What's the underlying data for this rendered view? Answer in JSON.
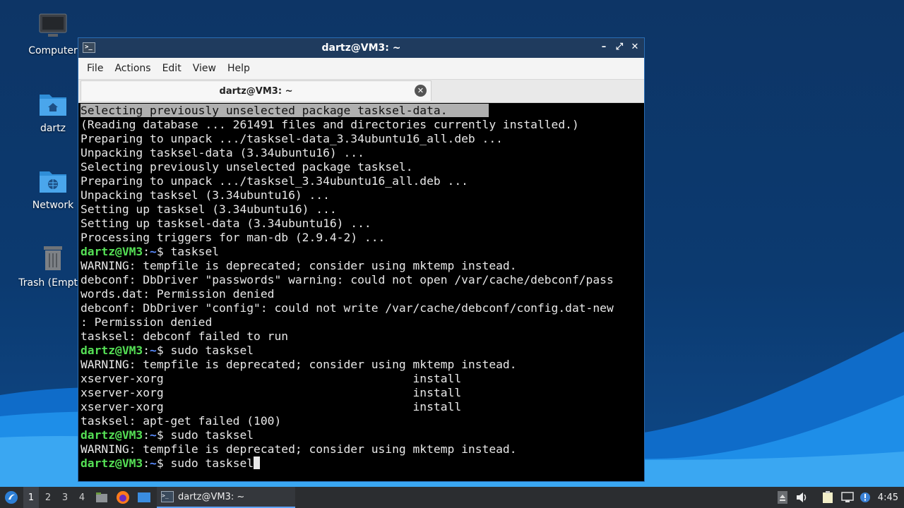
{
  "desktop": {
    "icons": [
      {
        "label": "Computer",
        "icon": "computer-icon"
      },
      {
        "label": "dartz",
        "icon": "home-folder-icon"
      },
      {
        "label": "Network",
        "icon": "network-folder-icon"
      },
      {
        "label": "Trash (Empty)",
        "icon": "trash-icon"
      }
    ]
  },
  "window": {
    "title": "dartz@VM3: ~",
    "controls": {
      "minimize": "–",
      "maximize": "⤢",
      "close": "✕"
    },
    "menu": [
      "File",
      "Actions",
      "Edit",
      "View",
      "Help"
    ],
    "tab": {
      "label": "dartz@VM3: ~",
      "close": "✕"
    }
  },
  "terminal": {
    "prompt_user": "dartz@VM3",
    "prompt_path": "~",
    "prompt_sym": "$",
    "lines": [
      {
        "text": "Selecting previously unselected package tasksel-data.      "
      },
      {
        "text": "(Reading database ... 261491 files and directories currently installed.)"
      },
      {
        "text": "Preparing to unpack .../tasksel-data_3.34ubuntu16_all.deb ..."
      },
      {
        "text": "Unpacking tasksel-data (3.34ubuntu16) ..."
      },
      {
        "text": "Selecting previously unselected package tasksel."
      },
      {
        "text": "Preparing to unpack .../tasksel_3.34ubuntu16_all.deb ..."
      },
      {
        "text": "Unpacking tasksel (3.34ubuntu16) ..."
      },
      {
        "text": "Setting up tasksel (3.34ubuntu16) ..."
      },
      {
        "text": "Setting up tasksel-data (3.34ubuntu16) ..."
      },
      {
        "text": "Processing triggers for man-db (2.9.4-2) ..."
      },
      {
        "cmd": " tasksel"
      },
      {
        "text": "WARNING: tempfile is deprecated; consider using mktemp instead."
      },
      {
        "text": "debconf: DbDriver \"passwords\" warning: could not open /var/cache/debconf/pass"
      },
      {
        "text": "words.dat: Permission denied"
      },
      {
        "text": "debconf: DbDriver \"config\": could not write /var/cache/debconf/config.dat-new"
      },
      {
        "text": ": Permission denied"
      },
      {
        "text": "tasksel: debconf failed to run"
      },
      {
        "cmd": " sudo tasksel"
      },
      {
        "text": "WARNING: tempfile is deprecated; consider using mktemp instead."
      },
      {
        "text": "xserver-xorg                                    install"
      },
      {
        "text": "xserver-xorg                                    install"
      },
      {
        "text": "xserver-xorg                                    install"
      },
      {
        "text": "tasksel: apt-get failed (100)"
      },
      {
        "cmd": " sudo tasksel"
      },
      {
        "text": "WARNING: tempfile is deprecated; consider using mktemp instead."
      },
      {
        "cmd": " sudo tasksel",
        "cursor": true
      }
    ]
  },
  "taskbar": {
    "start_icon": "start-menu-icon",
    "workspaces": [
      "1",
      "2",
      "3",
      "4"
    ],
    "active_workspace": "1",
    "launchers": [
      "file-manager-icon",
      "firefox-icon",
      "show-desktop-icon"
    ],
    "task": {
      "label": "dartz@VM3: ~",
      "icon": "terminal-icon"
    },
    "tray": [
      "eject-icon",
      "volume-icon",
      "clipboard-icon",
      "network-icon",
      "update-notifier-icon"
    ],
    "clock": "4:45"
  }
}
